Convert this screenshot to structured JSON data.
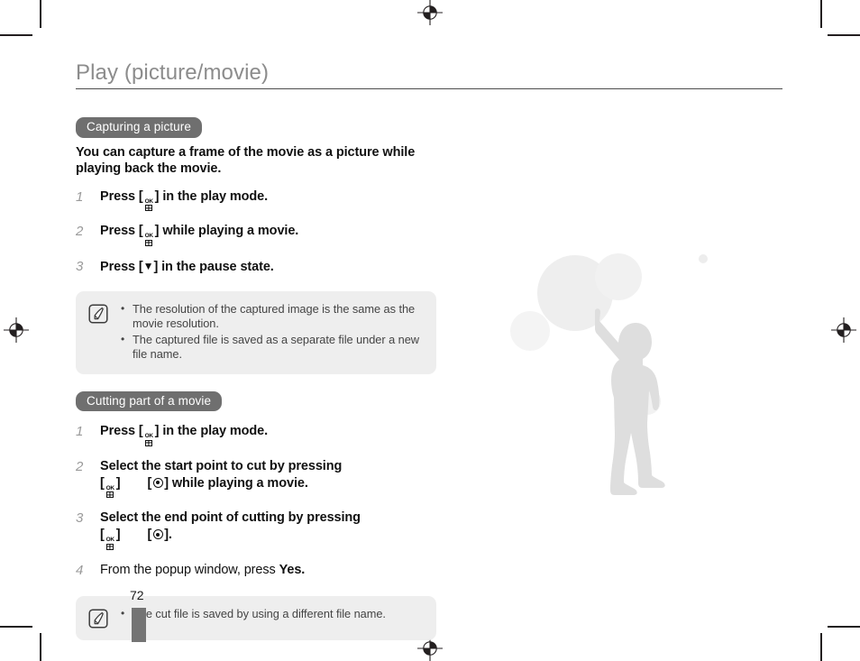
{
  "document": {
    "page_title": "Play (picture/movie)",
    "page_number": "72"
  },
  "sections": [
    {
      "heading": "Capturing a picture",
      "intro": "You can capture a frame of the movie as a picture while playing back the movie.",
      "steps": [
        {
          "num": "1",
          "before": "Press [",
          "glyph": "ok-button-icon",
          "after": "] in the play mode."
        },
        {
          "num": "2",
          "before": "Press [",
          "glyph": "ok-button-icon",
          "after": "] while playing a movie."
        },
        {
          "num": "3",
          "before": "Press [",
          "glyph": "down-arrow-icon",
          "after": "] in the pause state."
        }
      ],
      "note": {
        "icon": "memo-pen-icon",
        "bullets": [
          "The resolution of the captured image is the same as the movie resolution.",
          "The captured file is saved as a separate file under a new file name."
        ]
      }
    },
    {
      "heading": "Cutting part of a movie",
      "steps": [
        {
          "num": "1",
          "line1_before": "Press [",
          "line1_after": "] in the play mode."
        },
        {
          "num": "2",
          "line1": "Select the start point to cut by pressing",
          "line2_after": "] while playing a movie."
        },
        {
          "num": "3",
          "line1": "Select the end point of cutting by pressing",
          "line2_after": "]."
        },
        {
          "num": "4",
          "before": "From the popup window, press ",
          "bold": "Yes."
        }
      ],
      "note": {
        "icon": "memo-pen-icon",
        "bullets": [
          "The cut file is saved by using a different file name."
        ]
      }
    }
  ],
  "icons": {
    "ok_label": "OK",
    "down_arrow": "▼",
    "bracket_open": "[",
    "bracket_close": "]"
  },
  "colors": {
    "title": "#8c8c8c",
    "pill_background": "#6f6f6f",
    "note_background": "#eeeeee",
    "thumb_tab": "#747474",
    "body_text": "#111111",
    "step_number": "#9a9a9a"
  }
}
